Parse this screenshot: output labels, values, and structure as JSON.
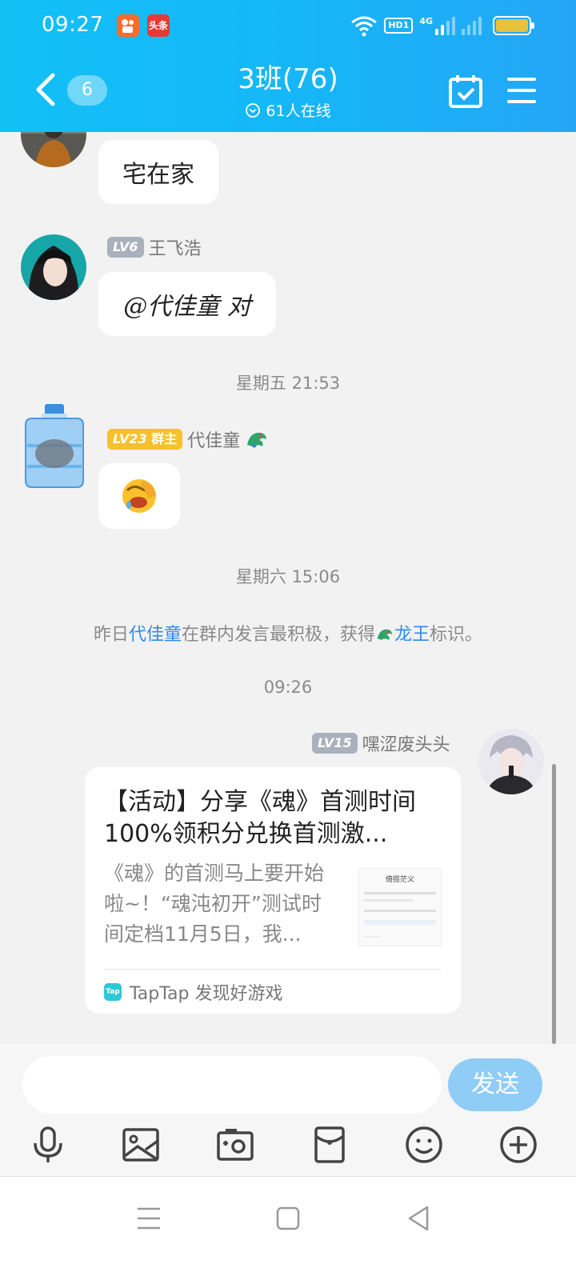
{
  "status_bar": {
    "time": "09:27",
    "toutiao_label": "头条",
    "hd_label": "HD1",
    "net_label": "4G",
    "battery_color": "#e8c23a"
  },
  "header": {
    "unread_count": "6",
    "title": "3班(76)",
    "online": "61人在线",
    "accent_color": "#15b7f8"
  },
  "messages": [
    {
      "text": "宅在家"
    },
    {
      "level": "LV6",
      "sender": "王飞浩",
      "text": "@代佳童 对"
    },
    {
      "level": "LV23",
      "role": "群主",
      "sender": "代佳童",
      "emoji": "face-palm-emoji"
    }
  ],
  "timestamps": [
    "星期五 21:53",
    "星期六 15:06",
    "09:26"
  ],
  "system_message": {
    "prefix": "昨日",
    "user": "代佳童",
    "middle": "在群内发言最积极，获得",
    "badge": "龙王",
    "suffix": "标识。"
  },
  "outgoing": {
    "level": "LV15",
    "sender": "嘿涩废头头",
    "card": {
      "title": "【活动】分享《魂》首测时间 100%领积分兑换首测激...",
      "description": "《魂》的首测马上要开始啦~！“魂沌初开”测试时间定档11月5日，我...",
      "thumb_heading": "倚揽茫义",
      "source": "TapTap 发现好游戏",
      "source_logo": "Tap"
    }
  },
  "input": {
    "placeholder": "",
    "send_label": "发送"
  },
  "toolbar_icons": [
    "microphone-icon",
    "image-icon",
    "camera-icon",
    "red-packet-icon",
    "emoji-icon",
    "plus-icon"
  ],
  "nav_icons": [
    "recents-icon",
    "home-icon",
    "back-icon"
  ]
}
